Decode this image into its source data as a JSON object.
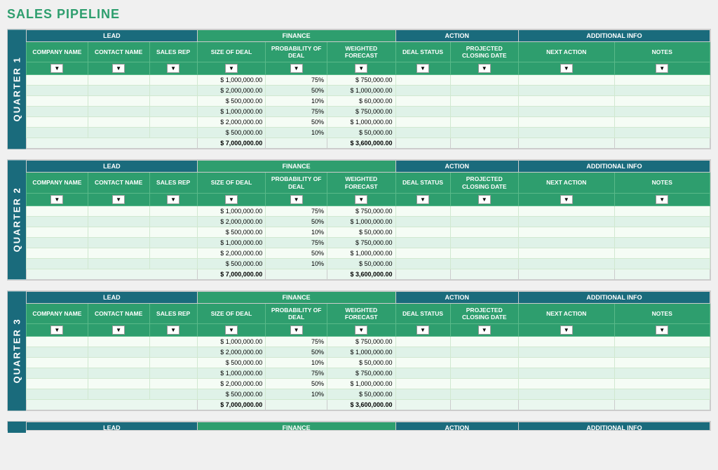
{
  "title": "SALES PIPELINE",
  "quarters": [
    {
      "label": "QUARTER 1",
      "rows": [
        {
          "deal": "$ 1,000,000.00",
          "prob": "75%",
          "weighted": "$ 750,000.00"
        },
        {
          "deal": "$ 2,000,000.00",
          "prob": "50%",
          "weighted": "$ 1,000,000.00"
        },
        {
          "deal": "$ 500,000.00",
          "prob": "10%",
          "weighted": "$ 60,000.00"
        },
        {
          "deal": "$ 1,000,000.00",
          "prob": "75%",
          "weighted": "$ 750,000.00"
        },
        {
          "deal": "$ 2,000,000.00",
          "prob": "50%",
          "weighted": "$ 1,000,000.00"
        },
        {
          "deal": "$ 500,000.00",
          "prob": "10%",
          "weighted": "$ 50,000.00"
        }
      ],
      "total_deal": "$ 7,000,000.00",
      "total_weighted": "$ 3,600,000.00"
    },
    {
      "label": "QUARTER 2",
      "rows": [
        {
          "deal": "$ 1,000,000.00",
          "prob": "75%",
          "weighted": "$ 750,000.00"
        },
        {
          "deal": "$ 2,000,000.00",
          "prob": "50%",
          "weighted": "$ 1,000,000.00"
        },
        {
          "deal": "$ 500,000.00",
          "prob": "10%",
          "weighted": "$ 50,000.00"
        },
        {
          "deal": "$ 1,000,000.00",
          "prob": "75%",
          "weighted": "$ 750,000.00"
        },
        {
          "deal": "$ 2,000,000.00",
          "prob": "50%",
          "weighted": "$ 1,000,000.00"
        },
        {
          "deal": "$ 500,000.00",
          "prob": "10%",
          "weighted": "$ 50,000.00"
        }
      ],
      "total_deal": "$ 7,000,000.00",
      "total_weighted": "$ 3,600,000.00"
    },
    {
      "label": "QUARTER 3",
      "rows": [
        {
          "deal": "$ 1,000,000.00",
          "prob": "75%",
          "weighted": "$ 750,000.00"
        },
        {
          "deal": "$ 2,000,000.00",
          "prob": "50%",
          "weighted": "$ 1,000,000.00"
        },
        {
          "deal": "$ 500,000.00",
          "prob": "10%",
          "weighted": "$ 50,000.00"
        },
        {
          "deal": "$ 1,000,000.00",
          "prob": "75%",
          "weighted": "$ 750,000.00"
        },
        {
          "deal": "$ 2,000,000.00",
          "prob": "50%",
          "weighted": "$ 1,000,000.00"
        },
        {
          "deal": "$ 500,000.00",
          "prob": "10%",
          "weighted": "$ 50,000.00"
        }
      ],
      "total_deal": "$ 7,000,000.00",
      "total_weighted": "$ 3,600,000.00"
    }
  ],
  "group_headers": {
    "lead": "LEAD",
    "finance": "FINANCE",
    "action": "ACTION",
    "additional_info": "ADDITIONAL INFO"
  },
  "col_headers": {
    "company_name": "COMPANY NAME",
    "contact_name": "CONTACT NAME",
    "sales_rep": "SALES REP",
    "size_of_deal": "SIZE OF DEAL",
    "probability_of_deal": "PROBABILITY OF DEAL",
    "weighted_forecast": "WEIGHTED FORECAST",
    "deal_status": "DEAL STATUS",
    "projected_closing_date": "PROJECTED CLOSING DATE",
    "next_action": "NEXT ACTION",
    "notes": "NOTES"
  },
  "bottom_bar_label": "LEAD",
  "bottom_finance_label": "FINANCE",
  "bottom_action_label": "ACTION",
  "bottom_addinfo_label": "ADDITIONAL INFO"
}
